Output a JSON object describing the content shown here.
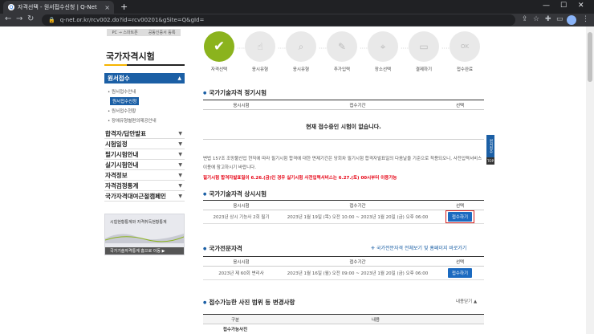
{
  "browser": {
    "tab_title": "자격선택 - 원서접수신청 | Q-Net",
    "new_tab": "+",
    "url": "q-net.or.kr/rcv002.do?id=rcv00201&gSite=Q&gId="
  },
  "sidebar": {
    "login_buttons": [
      "PC → 스마트폰",
      "공동인증서 등록"
    ],
    "title": "국가자격시험",
    "active_menu": "원서접수",
    "subitems": [
      {
        "label": "원서접수안내",
        "active": false
      },
      {
        "label": "원서접수신청",
        "active": true
      },
      {
        "label": "원서접수현황",
        "active": false
      },
      {
        "label": "장애유형별편의제공안내",
        "active": false
      }
    ],
    "menus": [
      "합격자/답안발표",
      "시험일정",
      "필기시험안내",
      "실기시험안내",
      "자격정보",
      "자격검정통계",
      "국가자격대여근절캠페인"
    ],
    "banner_text": "시험현황통계와 자격취득현황통계",
    "banner_button": "국가기술자격통계 홈으로 이동 ▶"
  },
  "steps": [
    {
      "label": "자격선택",
      "icon": "check-icon",
      "active": true
    },
    {
      "label": "응시유형",
      "icon": "hand-icon",
      "active": false
    },
    {
      "label": "응시유형",
      "icon": "search-icon",
      "active": false
    },
    {
      "label": "추가입력",
      "icon": "pencil-icon",
      "active": false
    },
    {
      "label": "장소선택",
      "icon": "location-icon",
      "active": false
    },
    {
      "label": "결제하기",
      "icon": "wallet-icon",
      "active": false
    },
    {
      "label": "접수완료",
      "icon": "ok-icon",
      "active": false
    }
  ],
  "regular": {
    "title": "국가기술자격 정기시험",
    "headers": [
      "응시시험",
      "접수기간",
      "선택"
    ],
    "empty_message": "현재 접수중인 시험이 없습니다.",
    "note": "변법 157조 조망불산업 현직에 따라 필기시험 합격에 대한 면제기간은 당회차 필기시험 합격자발표일의 다음날을 기준으로 적용되오니, 사전입력서비스 이용에 참고하시기 바랍니다.",
    "red_note": "필기시험 합격자발표일이 6.26.(금)인 경우 실기시험 사전입력서비스는 6.27.(토) 00시부터 이용가능"
  },
  "always": {
    "title": "국가기술자격 상시시험",
    "headers": [
      "응시시험",
      "접수기간",
      "선택"
    ],
    "rows": [
      {
        "exam": "2023년 상시 기능사 2회 필기",
        "period": "2023년 1월 19일 (목) 오전 10:00 ~ 2023년 1월 20일 (금) 오후 06:00",
        "button": "접수하기"
      }
    ]
  },
  "professional": {
    "title": "국가전문자격",
    "link": "국가전문자격 전체보기 및 홈페이지 바로가기",
    "headers": [
      "응시시험",
      "접수기간",
      "선택"
    ],
    "rows": [
      {
        "exam": "2023년 제 60회 변리사",
        "period": "2023년 1월 16일 (월) 오전 09:00 ~ 2023년 1월 20일 (금) 오후 06:00",
        "button": "접수하기"
      }
    ]
  },
  "photo": {
    "title": "접수가능한 사진 범위 등 변경사항",
    "toggle": "내용닫기",
    "headers": [
      "구분",
      "내용"
    ],
    "row_label": "접수가능사진"
  },
  "float": {
    "label": "원서접수",
    "top": "TOP"
  }
}
